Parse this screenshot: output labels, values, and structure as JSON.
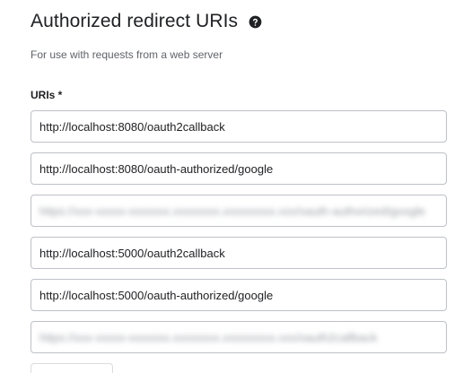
{
  "section": {
    "title": "Authorized redirect URIs",
    "help_icon": "help-circle-icon",
    "subtitle": "For use with requests from a web server",
    "field_label": "URIs *"
  },
  "uris": [
    {
      "value": "http://localhost:8080/oauth2callback",
      "redacted": false
    },
    {
      "value": "http://localhost:8080/oauth-authorized/google",
      "redacted": false
    },
    {
      "value": "https://xxx-xxxxx-xxxxxxx.xxxxxxxx.xxxxxxxxx.xxx/oauth-authorized/google",
      "redacted": true
    },
    {
      "value": "http://localhost:5000/oauth2callback",
      "redacted": false
    },
    {
      "value": "http://localhost:5000/oauth-authorized/google",
      "redacted": false
    },
    {
      "value": "https://xxx-xxxxx-xxxxxxx.xxxxxxxx.xxxxxxxxx.xxx/oauth2callback",
      "redacted": true
    }
  ],
  "colors": {
    "text": "#202124",
    "secondary_text": "#5f6368",
    "field_border": "#bdc1c6"
  }
}
